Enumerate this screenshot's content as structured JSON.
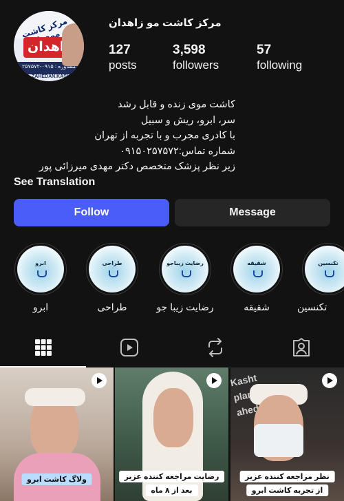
{
  "profile": {
    "name": "مرکز کاشت مو زاهدان",
    "avatar_title": "مرکز کاشت موی ابرو",
    "avatar_city": "زاهدان",
    "avatar_phone": "مشاوره : ۰۹۱۵-۲۵۷۵۷۲",
    "avatar_handle": "ZAHEDAN.KASHT"
  },
  "stats": [
    {
      "value": "127",
      "label": "posts"
    },
    {
      "value": "3,598",
      "label": "followers"
    },
    {
      "value": "57",
      "label": "following"
    }
  ],
  "bio": {
    "lines": [
      "کاشت موی زنده و قابل رشد",
      "سر، ابرو، ریش و سبیل",
      "با کادری مجرب و با تجربه از تهران",
      "شماره تماس:۰۹۱۵۰۲۵۷۵۷۲",
      "زیر نظر پزشک متخصص دکتر مهدی میرزائی پور"
    ],
    "see_translation": "See Translation"
  },
  "actions": {
    "follow": "Follow",
    "message": "Message"
  },
  "highlights": [
    {
      "title": "ابرو",
      "caption": "ابرو"
    },
    {
      "title": "طراحی",
      "caption": "طراحی"
    },
    {
      "title": "رضایت زیباجو",
      "caption": "رضایت زیبا جو"
    },
    {
      "title": "شقیقه",
      "caption": "شقیقه"
    },
    {
      "title": "تکنسین",
      "caption": "تکنسین"
    }
  ],
  "tabs": [
    {
      "icon": "grid-icon",
      "active": true
    },
    {
      "icon": "reels-icon",
      "active": false
    },
    {
      "icon": "repost-icon",
      "active": false
    },
    {
      "icon": "tagged-icon",
      "active": false
    }
  ],
  "posts": [
    {
      "caption": "ولاگ کاشت ابرو",
      "caption2": ""
    },
    {
      "caption": "رضایت مراجعه کننده عزیز",
      "caption2": "بعد از ۸ ماه"
    },
    {
      "caption": "نظر مراجعه کننده عزیز",
      "caption2": "از تجربه کاشت ابرو"
    }
  ],
  "colors": {
    "background": "#121212",
    "follow_button": "#4a5df9",
    "message_button": "#262626"
  }
}
